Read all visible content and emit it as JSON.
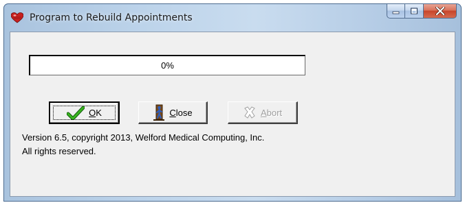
{
  "window": {
    "title": "Program to Rebuild Appointments",
    "app_icon": "red-heart-icon"
  },
  "caption_buttons": {
    "minimize_icon": "minimize-icon",
    "maximize_icon": "maximize-icon",
    "close_icon": "close-x-icon",
    "close_color": "#c7452a"
  },
  "progress": {
    "value_percent": 0,
    "label": "0%"
  },
  "buttons": {
    "ok": {
      "label_hotkey": "O",
      "label_rest": "K",
      "icon": "checkmark-icon",
      "icon_color": "#2a9a1a",
      "enabled": true,
      "default": true
    },
    "close": {
      "label_hotkey": "C",
      "label_rest": "lose",
      "icon": "door-exit-icon",
      "enabled": true
    },
    "abort": {
      "label_hotkey": "A",
      "label_rest": "bort",
      "icon": "abort-x-icon",
      "enabled": false
    }
  },
  "info": {
    "line1": "Version 6.5, copyright 2013, Welford Medical Computing, Inc.",
    "line2": "All rights reserved."
  }
}
